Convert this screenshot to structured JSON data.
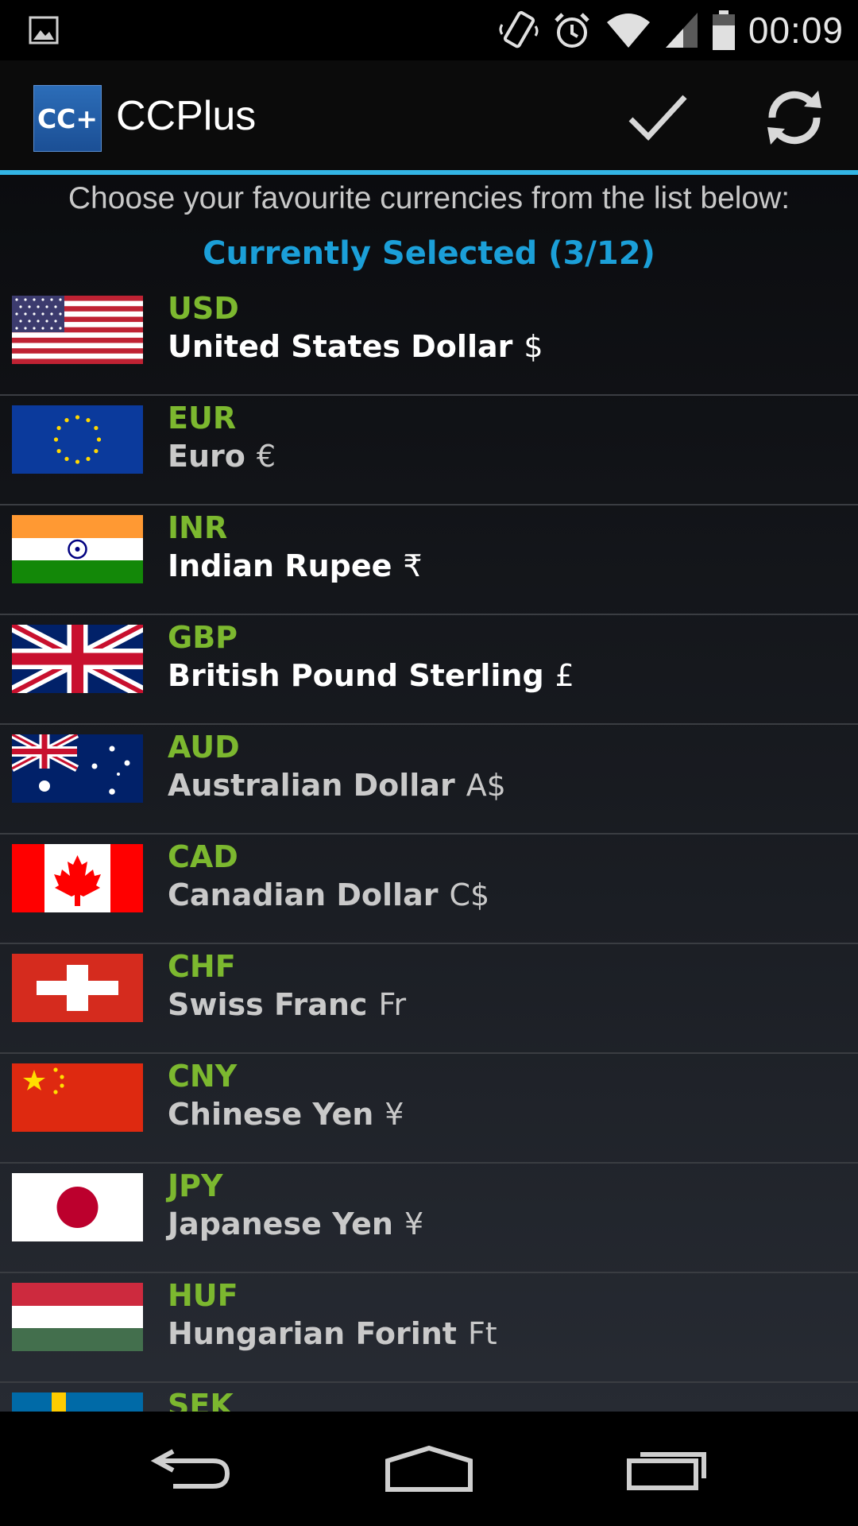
{
  "status_bar": {
    "time": "00:09",
    "icons": [
      "picture-icon",
      "vibrate-icon",
      "alarm-icon",
      "wifi-icon",
      "signal-icon",
      "battery-icon"
    ]
  },
  "action_bar": {
    "app_logo_text": "CC+",
    "title": "CCPlus",
    "actions": [
      "check-icon",
      "refresh-icon"
    ],
    "accent_color": "#33b5e5"
  },
  "content": {
    "instructions": "Choose your favourite currencies from the list below:",
    "selected_header": "Currently Selected (3/12)"
  },
  "currencies": [
    {
      "code": "USD",
      "name": "United States Dollar",
      "symbol": "$",
      "flag": "us-flag",
      "selected": true
    },
    {
      "code": "EUR",
      "name": "Euro",
      "symbol": "€",
      "flag": "eu-flag",
      "selected": false
    },
    {
      "code": "INR",
      "name": "Indian Rupee",
      "symbol": "₹",
      "flag": "india-flag",
      "selected": true
    },
    {
      "code": "GBP",
      "name": "British Pound Sterling",
      "symbol": "£",
      "flag": "uk-flag",
      "selected": true
    },
    {
      "code": "AUD",
      "name": "Australian Dollar",
      "symbol": "A$",
      "flag": "australia-flag",
      "selected": false
    },
    {
      "code": "CAD",
      "name": "Canadian Dollar",
      "symbol": "C$",
      "flag": "canada-flag",
      "selected": false
    },
    {
      "code": "CHF",
      "name": "Swiss Franc",
      "symbol": "Fr",
      "flag": "switzerland-flag",
      "selected": false
    },
    {
      "code": "CNY",
      "name": "Chinese Yen",
      "symbol": "¥",
      "flag": "china-flag",
      "selected": false
    },
    {
      "code": "JPY",
      "name": "Japanese Yen",
      "symbol": "¥",
      "flag": "japan-flag",
      "selected": false
    },
    {
      "code": "HUF",
      "name": "Hungarian Forint",
      "symbol": "Ft",
      "flag": "hungary-flag",
      "selected": false
    },
    {
      "code": "SEK",
      "name": "",
      "symbol": "",
      "flag": "sweden-flag",
      "selected": false
    }
  ],
  "nav_bar": {
    "buttons": [
      "back-icon",
      "home-icon",
      "recents-icon"
    ]
  },
  "colors": {
    "code_green": "#7cb82f",
    "header_blue": "#1b9fd8"
  }
}
